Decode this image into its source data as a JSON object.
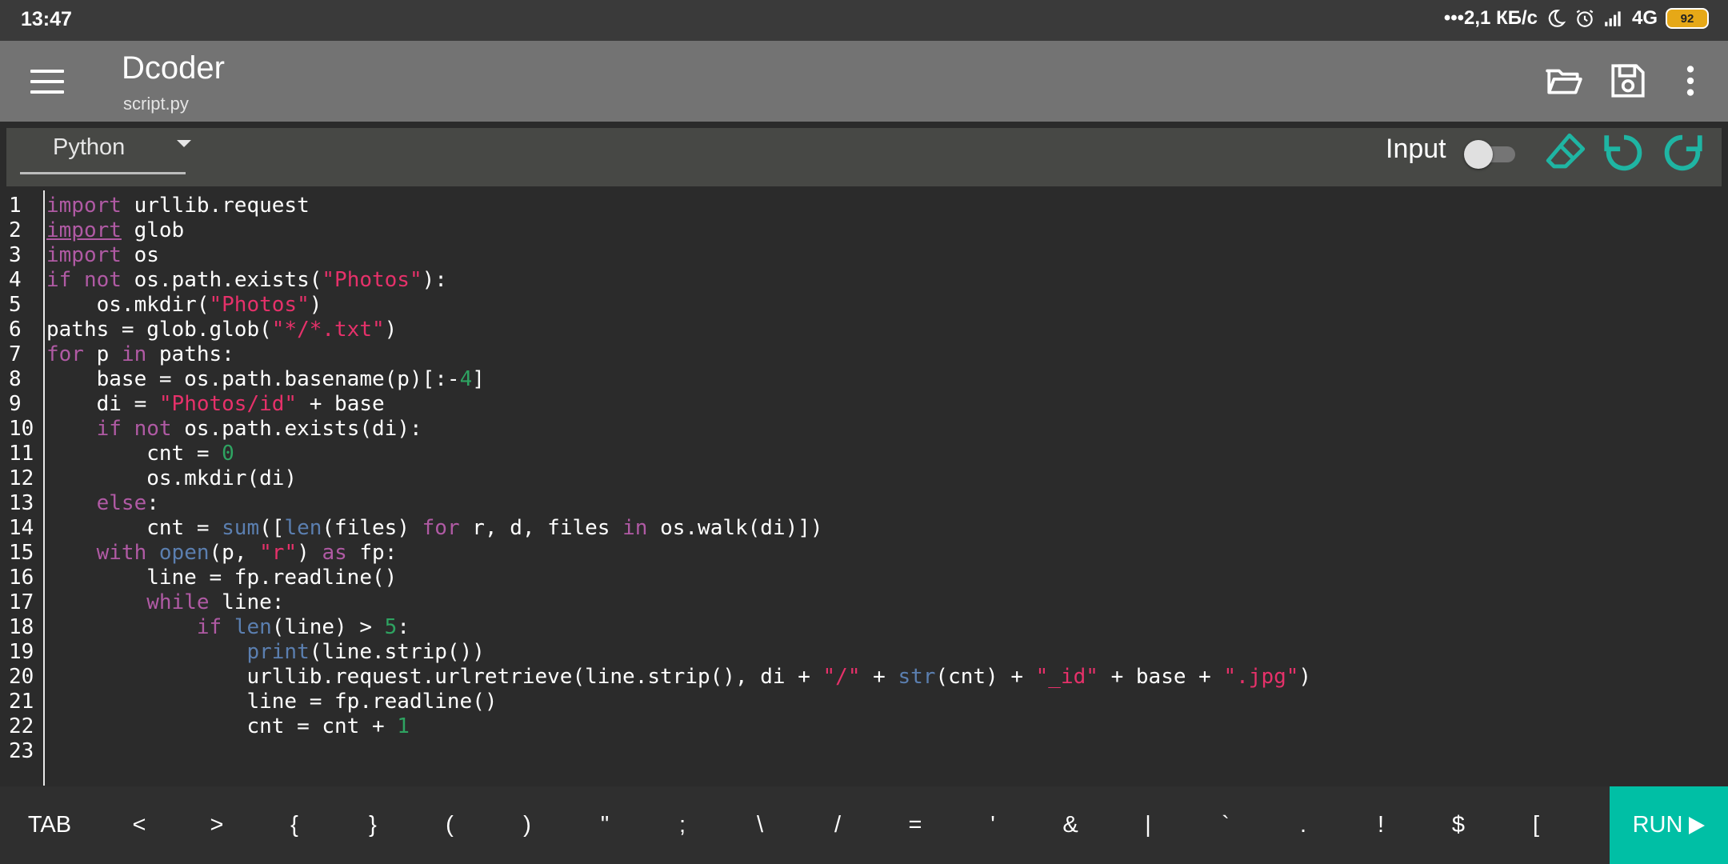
{
  "status_bar": {
    "time": "13:47",
    "net_speed": "•••2,1 КБ/с",
    "network": "4G",
    "battery": "92"
  },
  "app_bar": {
    "title": "Dcoder",
    "subtitle": "script.py",
    "icons": [
      "menu-icon",
      "folder-open-icon",
      "save-icon",
      "more-vert-icon"
    ]
  },
  "toolbar": {
    "language": "Python",
    "input_label": "Input",
    "input_toggle": "off",
    "icons": [
      "eraser-icon",
      "undo-icon",
      "redo-icon"
    ],
    "icon_color": "#1fb5a3"
  },
  "editor": {
    "lines": [
      {
        "n": "1",
        "t": [
          [
            "k",
            "import"
          ],
          [
            "p",
            " urllib.request"
          ]
        ]
      },
      {
        "n": "2",
        "t": [
          [
            "ku",
            "import"
          ],
          [
            "p",
            " glob"
          ]
        ]
      },
      {
        "n": "3",
        "t": [
          [
            "k",
            "import"
          ],
          [
            "p",
            " os"
          ]
        ]
      },
      {
        "n": "4",
        "t": [
          [
            "k",
            "if"
          ],
          [
            "p",
            " "
          ],
          [
            "k",
            "not"
          ],
          [
            "p",
            " os.path.exists("
          ],
          [
            "s",
            "\"Photos\""
          ],
          [
            "p",
            "):"
          ]
        ]
      },
      {
        "n": "5",
        "t": [
          [
            "p",
            "    os.mkdir("
          ],
          [
            "s",
            "\"Photos\""
          ],
          [
            "p",
            ")"
          ]
        ]
      },
      {
        "n": "6",
        "t": [
          [
            "p",
            "paths = glob.glob("
          ],
          [
            "s",
            "\"*/*.txt\""
          ],
          [
            "p",
            ")"
          ]
        ]
      },
      {
        "n": "7",
        "t": [
          [
            "k",
            "for"
          ],
          [
            "p",
            " p "
          ],
          [
            "k",
            "in"
          ],
          [
            "p",
            " paths:"
          ]
        ]
      },
      {
        "n": "8",
        "t": [
          [
            "p",
            "    base = os.path.basename(p)[:-"
          ],
          [
            "n",
            "4"
          ],
          [
            "p",
            "]"
          ]
        ]
      },
      {
        "n": "9",
        "t": [
          [
            "p",
            "    di = "
          ],
          [
            "s",
            "\"Photos/id\""
          ],
          [
            "p",
            " + base"
          ]
        ]
      },
      {
        "n": "10",
        "t": [
          [
            "p",
            "    "
          ],
          [
            "k",
            "if"
          ],
          [
            "p",
            " "
          ],
          [
            "k",
            "not"
          ],
          [
            "p",
            " os.path.exists(di):"
          ]
        ]
      },
      {
        "n": "11",
        "t": [
          [
            "p",
            "        cnt = "
          ],
          [
            "n",
            "0"
          ]
        ]
      },
      {
        "n": "12",
        "t": [
          [
            "p",
            "        os.mkdir(di)"
          ]
        ]
      },
      {
        "n": "13",
        "t": [
          [
            "p",
            "    "
          ],
          [
            "k",
            "else"
          ],
          [
            "p",
            ":"
          ]
        ]
      },
      {
        "n": "14",
        "t": [
          [
            "p",
            "        cnt = "
          ],
          [
            "b",
            "sum"
          ],
          [
            "p",
            "(["
          ],
          [
            "b",
            "len"
          ],
          [
            "p",
            "(files) "
          ],
          [
            "k",
            "for"
          ],
          [
            "p",
            " r, d, files "
          ],
          [
            "k",
            "in"
          ],
          [
            "p",
            " os.walk(di)])"
          ]
        ]
      },
      {
        "n": "15",
        "t": [
          [
            "p",
            "    "
          ],
          [
            "k",
            "with"
          ],
          [
            "p",
            " "
          ],
          [
            "b",
            "open"
          ],
          [
            "p",
            "(p, "
          ],
          [
            "s",
            "\"r\""
          ],
          [
            "p",
            ") "
          ],
          [
            "k",
            "as"
          ],
          [
            "p",
            " fp:"
          ]
        ]
      },
      {
        "n": "16",
        "t": [
          [
            "p",
            "        line = fp.readline()"
          ]
        ]
      },
      {
        "n": "17",
        "t": [
          [
            "p",
            "        "
          ],
          [
            "k",
            "while"
          ],
          [
            "p",
            " line:"
          ]
        ]
      },
      {
        "n": "18",
        "t": [
          [
            "p",
            "            "
          ],
          [
            "k",
            "if"
          ],
          [
            "p",
            " "
          ],
          [
            "b",
            "len"
          ],
          [
            "p",
            "(line) > "
          ],
          [
            "n",
            "5"
          ],
          [
            "p",
            ":"
          ]
        ]
      },
      {
        "n": "19",
        "t": [
          [
            "p",
            "                "
          ],
          [
            "b",
            "print"
          ],
          [
            "p",
            "(line.strip())"
          ]
        ]
      },
      {
        "n": "20",
        "t": [
          [
            "p",
            "                urllib.request.urlretrieve(line.strip(), di + "
          ],
          [
            "s",
            "\"/\""
          ],
          [
            "p",
            " + "
          ],
          [
            "b",
            "str"
          ],
          [
            "p",
            "(cnt) + "
          ],
          [
            "s",
            "\"_id\""
          ],
          [
            "p",
            " + base + "
          ],
          [
            "s",
            "\".jpg\""
          ],
          [
            "p",
            ")"
          ]
        ]
      },
      {
        "n": "21",
        "t": [
          [
            "p",
            "                line = fp.readline()"
          ]
        ]
      },
      {
        "n": "22",
        "t": [
          [
            "p",
            "                cnt = cnt + "
          ],
          [
            "n",
            "1"
          ]
        ]
      },
      {
        "n": "23",
        "t": []
      }
    ]
  },
  "key_bar": {
    "keys": [
      "TAB",
      "<",
      ">",
      "{",
      "}",
      "(",
      ")",
      "\"",
      ";",
      "\\",
      "/",
      "=",
      "'",
      "&",
      "|",
      "`",
      ".",
      "!",
      "$",
      "["
    ],
    "run_label": "RUN",
    "run_color": "#00bfa5"
  }
}
